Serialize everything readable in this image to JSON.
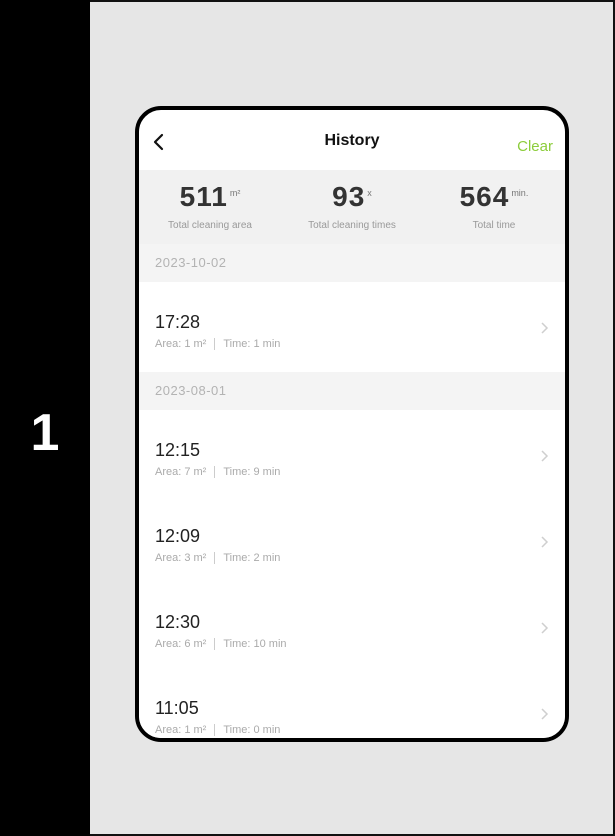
{
  "step": {
    "number": "1"
  },
  "header": {
    "back_icon": "chevron-left-icon",
    "title": "History",
    "clear_label": "Clear"
  },
  "stats": [
    {
      "value": "511",
      "unit": "m²",
      "label": "Total cleaning area"
    },
    {
      "value": "93",
      "unit": "x",
      "label": "Total cleaning times"
    },
    {
      "value": "564",
      "unit": "min.",
      "label": "Total time"
    }
  ],
  "groups": [
    {
      "date": "2023-10-02",
      "entries": [
        {
          "time": "17:28",
          "area": "Area: 1 m²",
          "duration": "Time: 1 min"
        }
      ]
    },
    {
      "date": "2023-08-01",
      "entries": [
        {
          "time": "12:15",
          "area": "Area: 7 m²",
          "duration": "Time: 9 min"
        },
        {
          "time": "12:09",
          "area": "Area: 3 m²",
          "duration": "Time: 2 min"
        },
        {
          "time": "12:30",
          "area": "Area: 6 m²",
          "duration": "Time: 10 min"
        },
        {
          "time": "11:05",
          "area": "Area: 1 m²",
          "duration": "Time: 0 min"
        }
      ]
    }
  ],
  "colors": {
    "accent": "#8ccd3b",
    "panel_bg": "#e6e6e6",
    "left_bar": "#000000"
  }
}
